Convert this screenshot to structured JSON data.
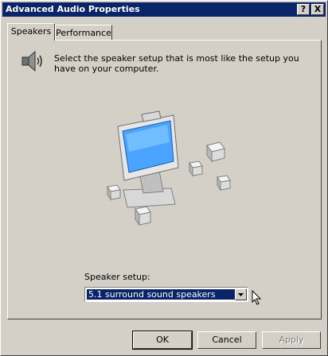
{
  "window": {
    "title": "Advanced Audio Properties"
  },
  "title_buttons": {
    "help": "?",
    "close": "X"
  },
  "tabs": [
    {
      "label": "Speakers",
      "active": true
    },
    {
      "label": "Performance",
      "active": false
    }
  ],
  "speakers_tab": {
    "description": "Select the speaker setup that is most like the setup you have on your computer.",
    "setup_label": "Speaker setup:",
    "setup_value": "5.1 surround sound speakers"
  },
  "buttons": {
    "ok": "OK",
    "cancel": "Cancel",
    "apply": "Apply"
  },
  "colors": {
    "face": "#d4d0c8",
    "title_bar": "#0a246a",
    "selection": "#0a246a"
  }
}
